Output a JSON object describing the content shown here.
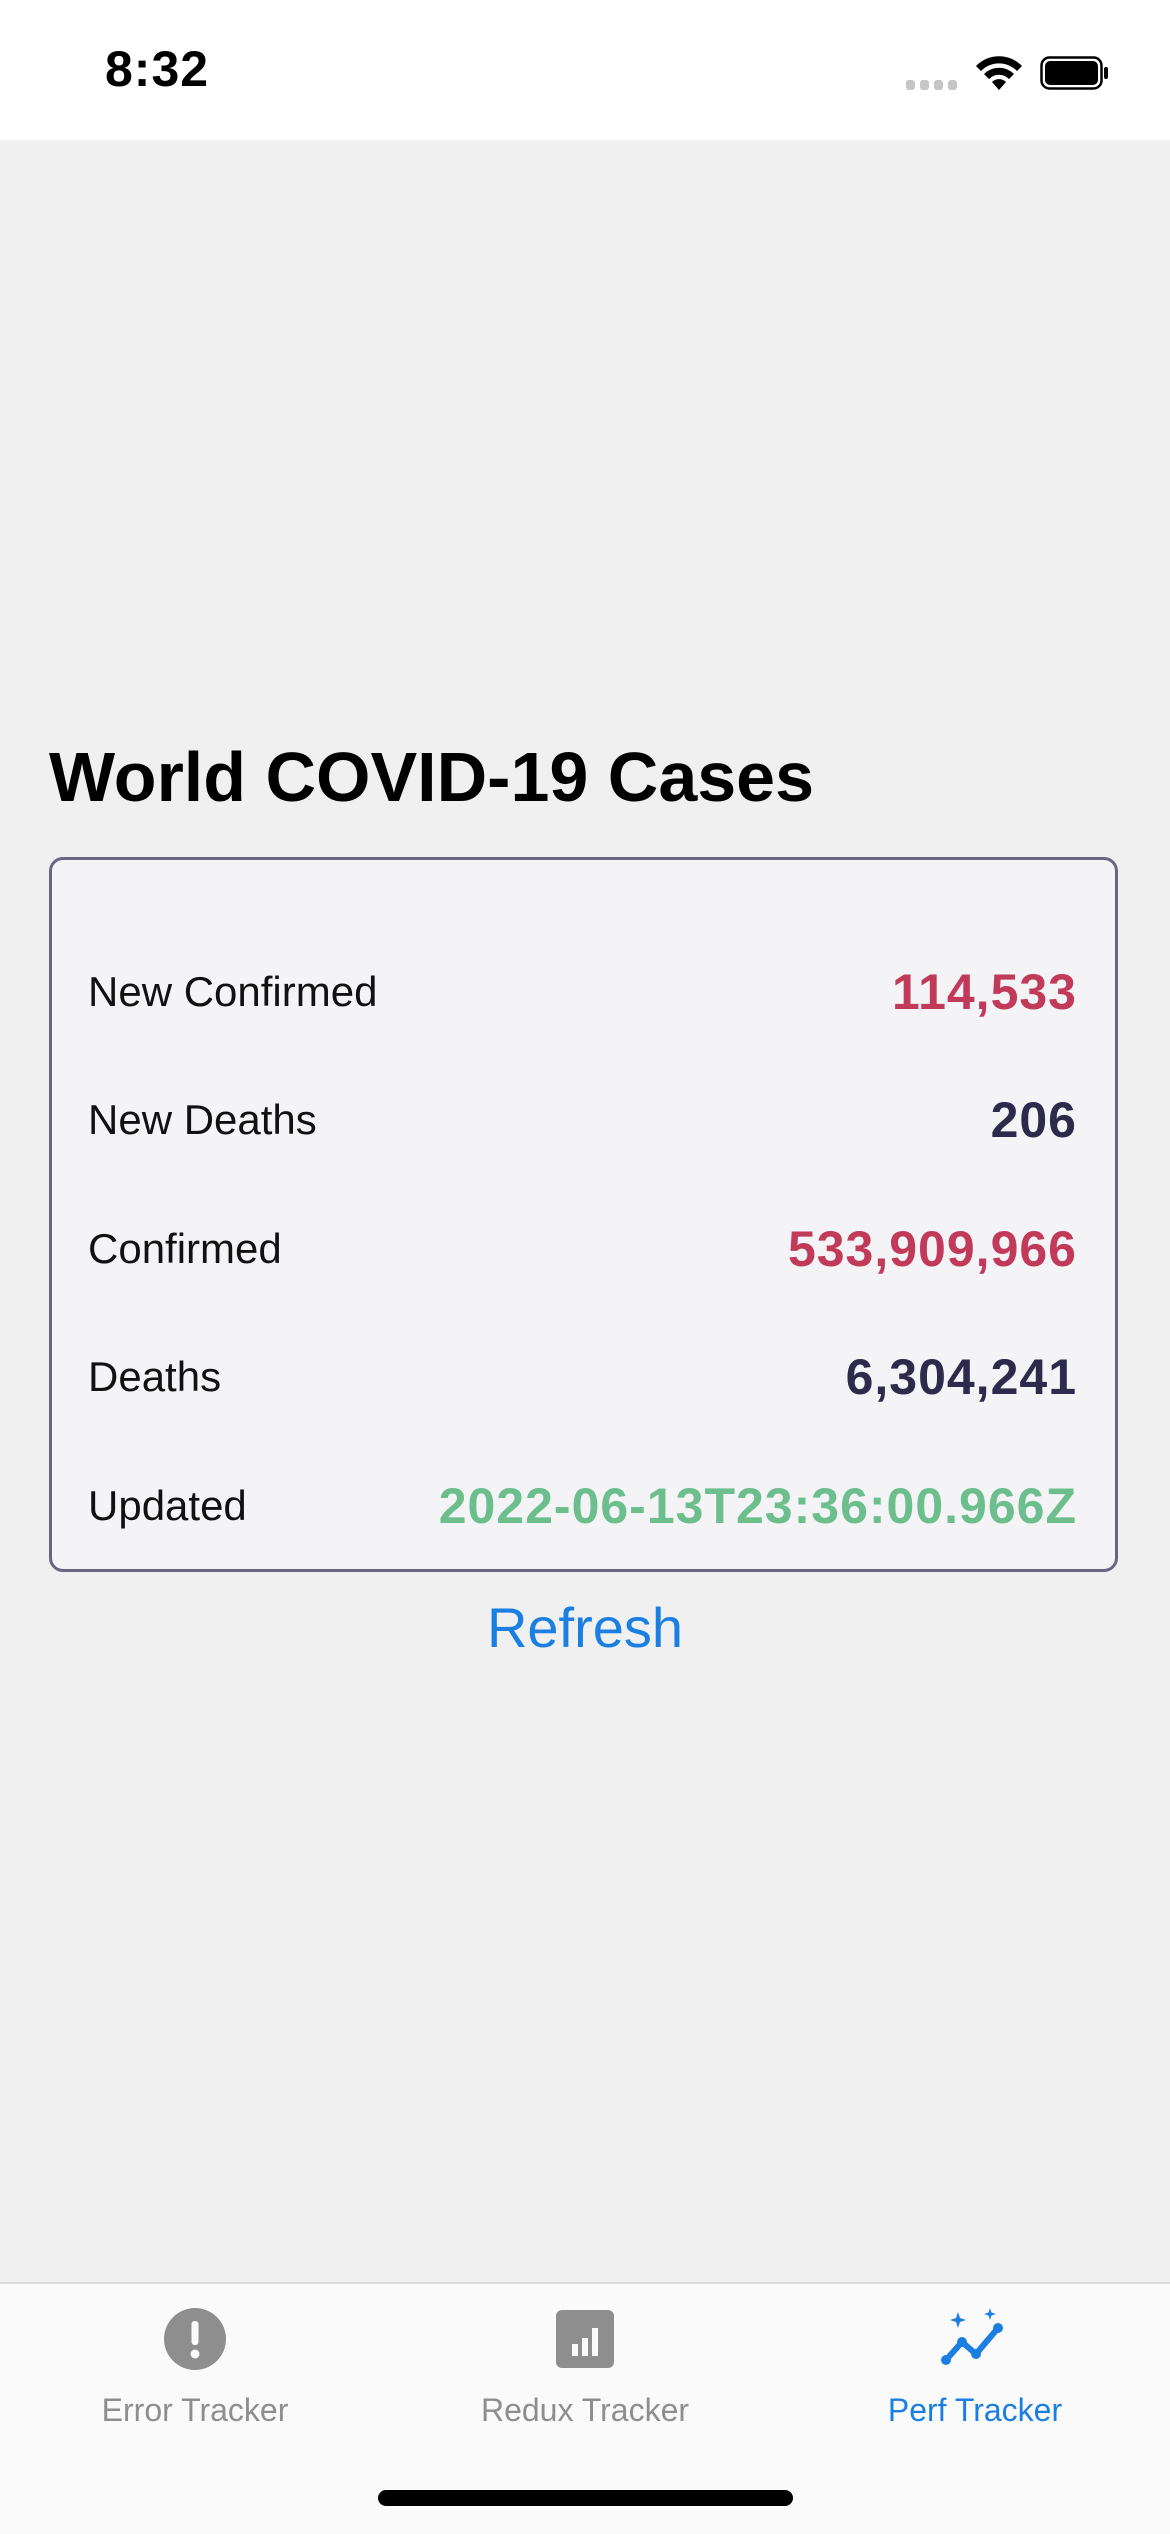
{
  "status_bar": {
    "time": "8:32"
  },
  "main": {
    "title": "World COVID-19 Cases",
    "stats": [
      {
        "label": "New Confirmed",
        "value": "114,533",
        "color": "#c13a5a"
      },
      {
        "label": "New Deaths",
        "value": "206",
        "color": "#2d2a4c"
      },
      {
        "label": "Confirmed",
        "value": "533,909,966",
        "color": "#c13a5a"
      },
      {
        "label": "Deaths",
        "value": "6,304,241",
        "color": "#2d2a4c"
      },
      {
        "label": "Updated",
        "value": "2022-06-13T23:36:00.966Z",
        "color": "#6cbf8c"
      }
    ],
    "refresh_label": "Refresh"
  },
  "tab_bar": {
    "active_tab": "Perf Tracker",
    "tabs": [
      {
        "label": "Error Tracker",
        "icon": "exclamation-circle-icon"
      },
      {
        "label": "Redux Tracker",
        "icon": "bar-chart-icon"
      },
      {
        "label": "Perf Tracker",
        "icon": "sparkle-line-chart-icon"
      }
    ]
  },
  "colors": {
    "accent": "#1a7fe0",
    "inactive_tab": "#8e8e8e",
    "card_border": "#6b6585"
  }
}
